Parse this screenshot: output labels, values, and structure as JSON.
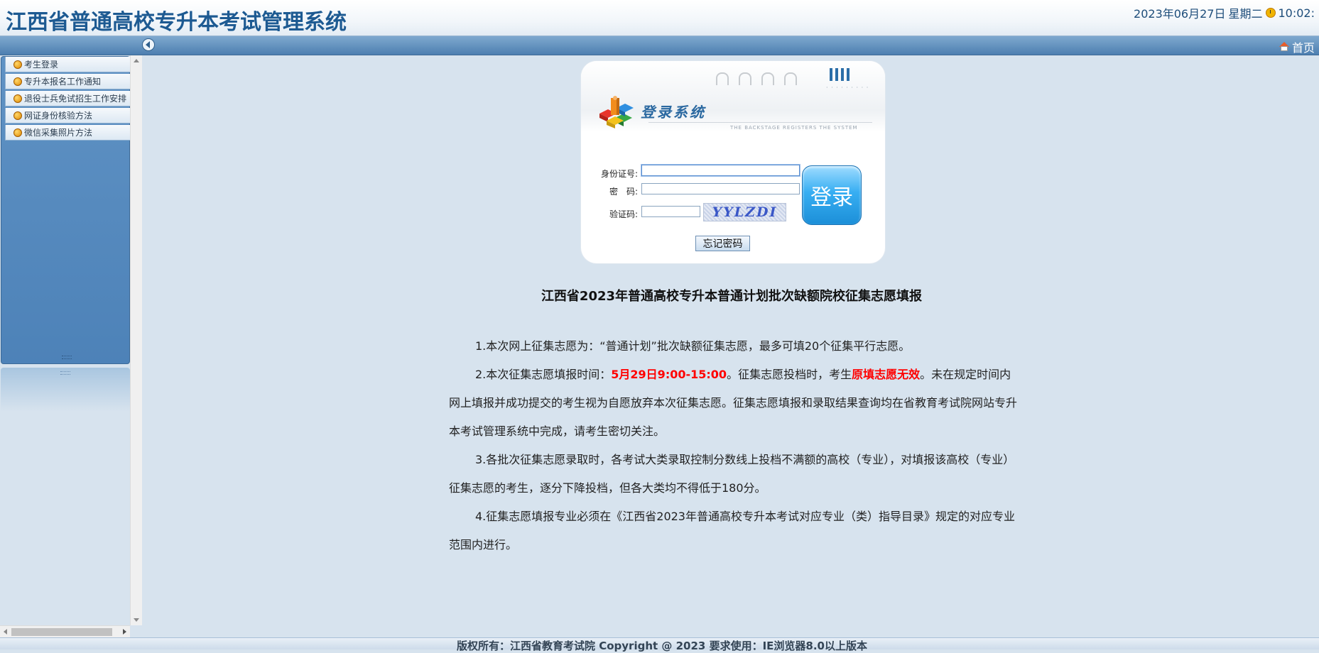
{
  "header": {
    "title": "江西省普通高校专升本考试管理系统",
    "date": "2023年06月27日",
    "weekday": "星期二",
    "time": "10:02:"
  },
  "nav": {
    "home_label": "首页"
  },
  "sidebar": {
    "items": [
      {
        "label": "考生登录"
      },
      {
        "label": "专升本报名工作通知"
      },
      {
        "label": "退役士兵免试招生工作安排"
      },
      {
        "label": "网证身份核验方法"
      },
      {
        "label": "微信采集照片方法"
      }
    ]
  },
  "login": {
    "heading": "登录系统",
    "subtitle": "THE BACKSTAGE REGISTERS THE SYSTEM",
    "id_label": "身份证号:",
    "password_label": "密　码:",
    "captcha_label": "验证码:",
    "id_value": "",
    "password_value": "",
    "captcha_value": "",
    "captcha_text": "YYLZDI",
    "login_button": "登录",
    "forgot_button": "忘记密码"
  },
  "notice": {
    "title": "江西省2023年普通高校专升本普通计划批次缺额院校征集志愿填报",
    "p1": "1.本次网上征集志愿为：“普通计划”批次缺额征集志愿，最多可填20个征集平行志愿。",
    "p2_a": "2.本次征集志愿填报时间：",
    "p2_time": "5月29日9:00-15:00",
    "p2_b": "。征集志愿投档时，考生",
    "p2_red": "原填志愿无效",
    "p2_c": "。未在规定时间内网上填报并成功提交的考生视为自愿放弃本次征集志愿。征集志愿填报和录取结果查询均在省教育考试院网站专升本考试管理系统中完成，请考生密切关注。",
    "p3": "3.各批次征集志愿录取时，各考试大类录取控制分数线上投档不满额的高校（专业），对填报该高校（专业）征集志愿的考生，逐分下降投档，但各大类均不得低于180分。",
    "p4": "4.征集志愿填报专业必须在《江西省2023年普通高校专升本考试对应专业（类）指导目录》规定的对应专业范围内进行。"
  },
  "footer": {
    "text": "版权所有：江西省教育考试院 Copyright @ 2023 要求使用：IE浏览器8.0以上版本"
  },
  "colors": {
    "title_blue": "#1d5a92",
    "nav_blue": "#4d7fb0",
    "background": "#d7e3ee",
    "highlight_red": "#ff0000"
  },
  "icons": [
    "clock-icon",
    "home-icon",
    "collapse-arrow-icon",
    "menu-bullet-icon",
    "login-logo-icon"
  ]
}
